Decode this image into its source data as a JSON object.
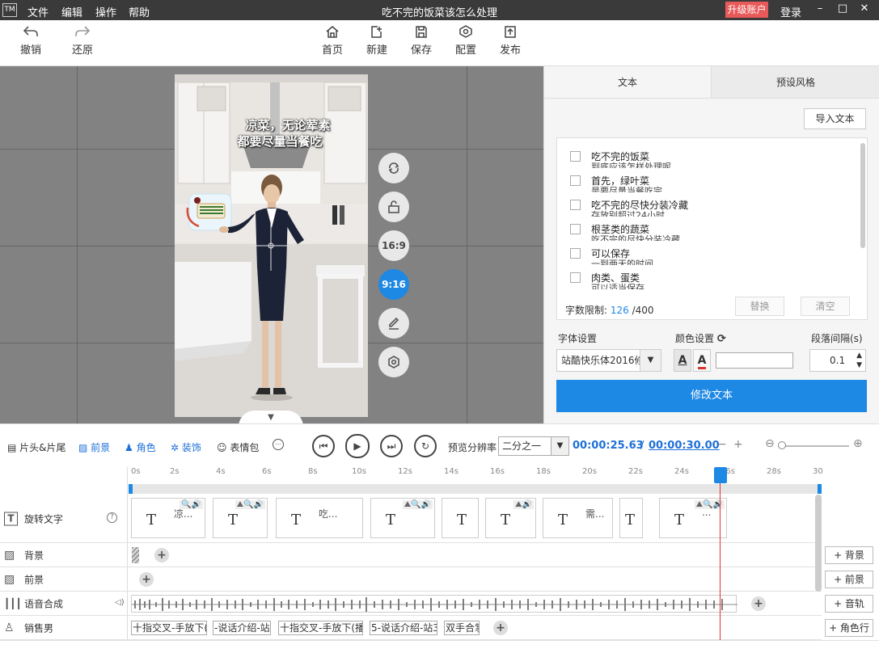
{
  "app": {
    "logo": "TM",
    "menus": [
      "文件",
      "编辑",
      "操作",
      "帮助"
    ],
    "title": "吃不完的饭菜该怎么处理",
    "upgrade": "升级账户",
    "login": "登录",
    "window_controls": [
      "minimize-icon",
      "maximize-icon",
      "close-icon"
    ]
  },
  "toolbar": {
    "undo": "撤销",
    "redo": "还原",
    "home": "首页",
    "new": "新建",
    "save": "保存",
    "config": "配置",
    "publish": "发布"
  },
  "preview": {
    "caption_line1": "凉菜，无论荤素",
    "caption_line2": "都要尽量当餐吃",
    "side_buttons": {
      "rotate": "rotate-icon",
      "unlock": "unlock-icon",
      "ratio_169": "16:9",
      "ratio_916": "9:16",
      "edit": "edit-icon",
      "settings": "settings-icon"
    }
  },
  "right_panel": {
    "tab_text": "文本",
    "tab_preset": "预设风格",
    "import_text": "导入文本",
    "text_items": [
      {
        "main": "吃不完的饭菜",
        "sub": "到底应该怎样处理呢"
      },
      {
        "main": "首先，绿叶菜",
        "sub": "是要尽量当餐吃完"
      },
      {
        "main": "吃不完的尽快分装冷藏",
        "sub": "存放别超过24小时"
      },
      {
        "main": "根茎类的蔬菜",
        "sub": "吃不完的尽快分装冷藏"
      },
      {
        "main": "可以保存",
        "sub": "一到两天的时间"
      },
      {
        "main": "肉类、蛋类",
        "sub": "可以适当保存"
      }
    ],
    "limit_label": "字数限制:",
    "limit_used": "126",
    "limit_total": "/400",
    "replace": "替换",
    "clear": "清空",
    "font_label": "字体设置",
    "color_label": "颜色设置",
    "spacing_label": "段落间隔(s)",
    "font_value": "站酷快乐体2016修订版",
    "spacing_value": "0.1",
    "modify_text": "修改文本"
  },
  "timeline_toolbar": {
    "intro_outro": "片头&片尾",
    "foreground": "前景",
    "character": "角色",
    "decoration": "装饰",
    "emoji": "表情包",
    "more": "···",
    "resolution_label": "预览分辨率",
    "resolution_value": "二分之一",
    "time_current": "00:00:25.63",
    "time_sep": "/",
    "time_total": "00:00:30.00",
    "zoom_minus": "−",
    "zoom_plus": "+"
  },
  "ruler": [
    "0s",
    "2s",
    "4s",
    "6s",
    "8s",
    "10s",
    "12s",
    "14s",
    "16s",
    "18s",
    "20s",
    "22s",
    "24s",
    "26s",
    "28s",
    "30"
  ],
  "tracks": {
    "rotate_text": "旋转文字",
    "help": "?",
    "background": "背景",
    "foreground": "前景",
    "tts": "语音合成",
    "character": "销售男"
  },
  "text_clips": [
    {
      "text": "凉..."
    },
    {
      "text": ""
    },
    {
      "text": "吃..."
    },
    {
      "text": ""
    },
    {
      "text": ""
    },
    {
      "text": ""
    },
    {
      "text": "需..."
    },
    {
      "text": ""
    },
    {
      "text": "..."
    }
  ],
  "poses": [
    "十指交叉-手放下(",
    "-说话介绍-站",
    "十指交叉-手放下(播",
    "5-说话介绍-站3",
    "双手合掌"
  ],
  "add_buttons": {
    "background": "+ 背景",
    "foreground": "+ 前景",
    "audio": "+ 音轨",
    "character": "+ 角色行"
  }
}
